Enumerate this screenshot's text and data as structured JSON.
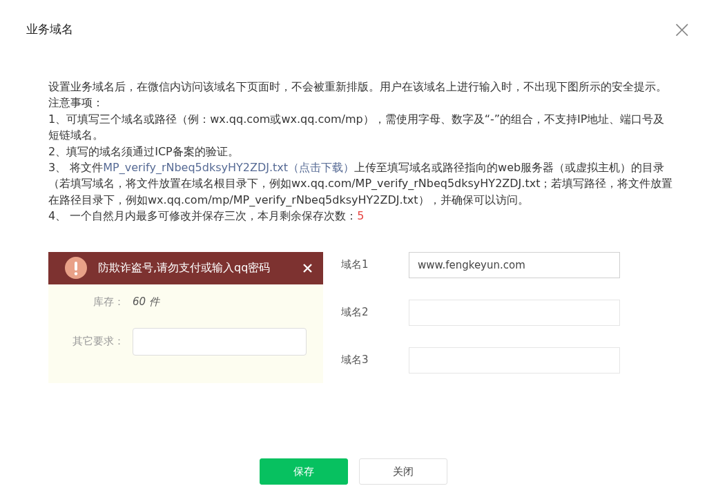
{
  "dialog": {
    "title": "业务域名",
    "close": "×"
  },
  "intro": "设置业务域名后，在微信内访问该域名下页面时，不会被重新排版。用户在该域名上进行输入时，不出现下图所示的安全提示。",
  "notes_title": "注意事项：",
  "notes": [
    {
      "parts": [
        {
          "kind": "text",
          "text": "1、可填写三个域名或路径（例：wx.qq.com或wx.qq.com/mp），需使用字母、数字及“-”的组合，不支持IP地址、端口号及短链域名。"
        }
      ]
    },
    {
      "parts": [
        {
          "kind": "text",
          "text": "2、填写的域名须通过ICP备案的验证。"
        }
      ]
    },
    {
      "parts": [
        {
          "kind": "text",
          "text": "3、 将文件"
        },
        {
          "kind": "link",
          "text": "MP_verify_rNbeq5dksyHY2ZDJ.txt（点击下载）"
        },
        {
          "kind": "text",
          "text": "上传至填写域名或路径指向的web服务器（或虚拟主机）的目录（若填写域名，将文件放置在域名根目录下，例如wx.qq.com/MP_verify_rNbeq5dksyHY2ZDJ.txt；若填写路径，将文件放置在路径目录下，例如wx.qq.com/mp/MP_verify_rNbeq5dksyHY2ZDJ.txt），并确保可以访问。"
        }
      ]
    },
    {
      "parts": [
        {
          "kind": "text",
          "text": "4、 一个自然月内最多可修改并保存三次，本月剩余保存次数："
        },
        {
          "kind": "count",
          "text": "5"
        }
      ]
    }
  ],
  "example": {
    "warning": "防欺诈盗号,请勿支付或输入qq密码",
    "rows": [
      {
        "kind": "value",
        "label": "库存：",
        "value": "60 件"
      },
      {
        "kind": "input",
        "label": "其它要求："
      }
    ]
  },
  "domains": [
    {
      "label": "域名1",
      "value": "www.fengkeyun.com",
      "focused": true
    },
    {
      "label": "域名2",
      "focused": false
    },
    {
      "label": "域名3",
      "focused": false
    }
  ],
  "buttons": [
    {
      "kind": "primary",
      "label": "保存"
    },
    {
      "kind": "default",
      "label": "关闭"
    }
  ]
}
